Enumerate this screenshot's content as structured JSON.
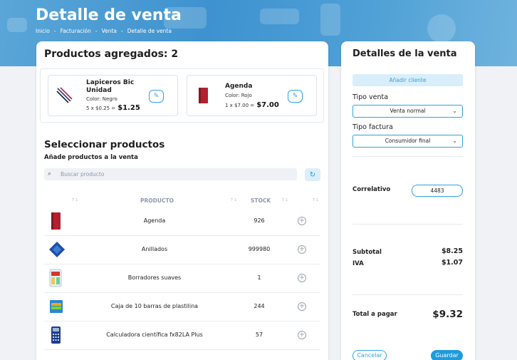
{
  "header": {
    "title": "Detalle de venta",
    "breadcrumb": [
      "Inicio",
      "-",
      "Facturación",
      "-",
      "Venta",
      "-",
      "Detalle de venta"
    ]
  },
  "added": {
    "title": "Productos agregados: 2",
    "items": [
      {
        "name": "Lapiceros Bic Unidad",
        "color_label": "Color: Negro",
        "calc": "5 x $0.25 =",
        "total": "$1.25"
      },
      {
        "name": "Agenda",
        "color_label": "Color: Rojo",
        "calc": "1 x $7.00 =",
        "total": "$7.00"
      }
    ]
  },
  "select_products": {
    "title": "Seleccionar productos",
    "subtitle": "Añade productos a la venta",
    "search_placeholder": "Buscar producto",
    "columns": {
      "product": "PRODUCTO",
      "stock": "STOCK"
    },
    "rows": [
      {
        "name": "Agenda",
        "stock": "926",
        "thumb": "red-agenda"
      },
      {
        "name": "Anillados",
        "stock": "999980",
        "thumb": "blue-ring-binder"
      },
      {
        "name": "Borradores suaves",
        "stock": "1",
        "thumb": "eraser-pack"
      },
      {
        "name": "Caja de 10 barras de plastilina",
        "stock": "244",
        "thumb": "plasticine-box"
      },
      {
        "name": "Calculadora científica fx82LA Plus",
        "stock": "57",
        "thumb": "calculator"
      }
    ]
  },
  "sale": {
    "title": "Detalles de la venta",
    "add_client": "Añadir cliente",
    "sale_type_label": "Tipo venta",
    "sale_type_value": "Venta normal",
    "invoice_type_label": "Tipo factura",
    "invoice_type_value": "Consumidor final",
    "correlative_label": "Correlativo",
    "correlative_value": "4483",
    "subtotal_label": "Subtotal",
    "subtotal_value": "$8.25",
    "iva_label": "IVA",
    "iva_value": "$1.07",
    "total_label": "Total a pagar",
    "total_value": "$9.32",
    "cancel": "Cancelar",
    "save": "Guardar"
  },
  "colors": {
    "accent": "#2ea3dd",
    "primary_button": "#1e9bdc",
    "banner": "#3e92cf"
  }
}
